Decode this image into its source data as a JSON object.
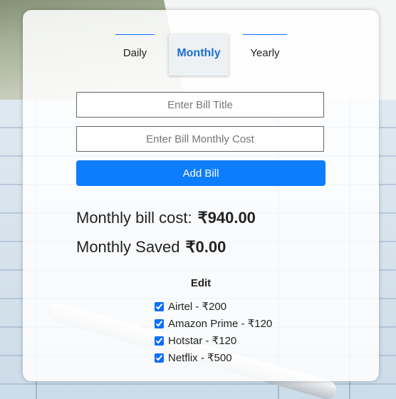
{
  "tabs": [
    {
      "label": "Daily",
      "active": false
    },
    {
      "label": "Monthly",
      "active": true
    },
    {
      "label": "Yearly",
      "active": false
    }
  ],
  "form": {
    "title_placeholder": "Enter Bill Title",
    "cost_placeholder": "Enter Bill Monthly Cost",
    "add_label": "Add Bill"
  },
  "summary": {
    "cost_label": "Monthly bill cost:",
    "cost_value": "₹940.00",
    "saved_label": "Monthly Saved",
    "saved_value": "₹0.00"
  },
  "edit_label": "Edit",
  "bills": [
    {
      "text": "Airtel - ₹200",
      "checked": true
    },
    {
      "text": "Amazon Prime - ₹120",
      "checked": true
    },
    {
      "text": "Hotstar - ₹120",
      "checked": true
    },
    {
      "text": "Netflix - ₹500",
      "checked": true
    }
  ],
  "colors": {
    "accent": "#0d7dfd",
    "active_tab": "#1a6fd1"
  }
}
